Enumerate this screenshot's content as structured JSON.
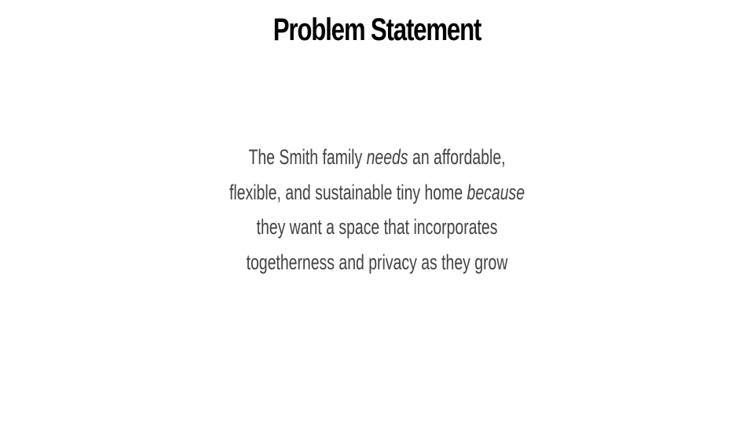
{
  "slide": {
    "title": "Problem Statement",
    "statement": {
      "line1": {
        "before": "The Smith family ",
        "emphasis": "needs",
        "after": " an affordable,"
      },
      "line2": {
        "before": "flexible, and sustainable tiny home ",
        "emphasis": "because"
      },
      "line3": "they want a space that incorporates",
      "line4": "togetherness and privacy as they grow"
    },
    "colors": {
      "title": "#000000",
      "body": "#424242",
      "background": "#ffffff"
    }
  }
}
